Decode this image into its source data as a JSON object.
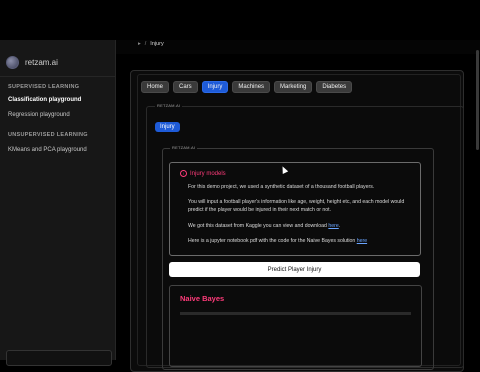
{
  "app": {
    "logo_text": "retzam.ai"
  },
  "sidebar": {
    "sections": [
      {
        "title": "SUPERVISED LEARNING",
        "items": [
          "Classification playground",
          "Regression playground"
        ]
      },
      {
        "title": "UNSUPERVISED LEARNING",
        "items": [
          "KMeans and PCA playground"
        ]
      }
    ]
  },
  "breadcrumb": {
    "current": "Injury"
  },
  "tabs": [
    "Home",
    "Cars",
    "Injury",
    "Machines",
    "Marketing",
    "Diabetes"
  ],
  "fieldset_labels": {
    "outer": "RETZAM.AI",
    "inner": "RETZAM.AI"
  },
  "injury_button": "Injury",
  "info": {
    "title": "Injury models",
    "p1": "For this demo project, we used a synthetic dataset of a thousand football players.",
    "p2": "You will input a football player's information like age, weight, height etc, and each model would predict if the player would be injured in their next match or not.",
    "p3_prefix": "We got this dataset from Kaggle you can view and download ",
    "p3_link": "here",
    "p3_suffix": ".",
    "p4_prefix": "Here is a jupyter notebook pdf with the code for the Naive Bayes solution ",
    "p4_link": "here"
  },
  "predict_button": "Predict Player Injury",
  "naive_bayes": {
    "title": "Naive Bayes"
  },
  "colors": {
    "accent_blue": "#1e5bd8",
    "accent_pink": "#ff3b7a"
  }
}
